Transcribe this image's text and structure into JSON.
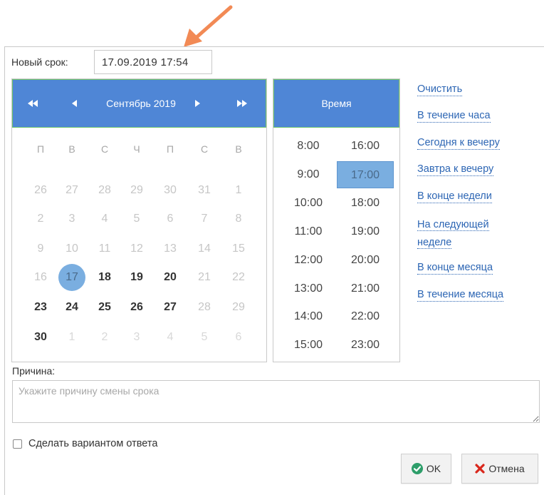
{
  "deadline": {
    "label": "Новый срок:",
    "value": "17.09.2019 17:54"
  },
  "calendar": {
    "month_title": "Сентябрь 2019",
    "weekdays": [
      "П",
      "В",
      "С",
      "Ч",
      "П",
      "С",
      "В"
    ],
    "weeks": [
      [
        [
          "26",
          "muted"
        ],
        [
          "27",
          "muted"
        ],
        [
          "28",
          "muted"
        ],
        [
          "29",
          "muted"
        ],
        [
          "30",
          "muted"
        ],
        [
          "31",
          "muted"
        ],
        [
          "1",
          "muted"
        ]
      ],
      [
        [
          "2",
          "muted"
        ],
        [
          "3",
          "muted"
        ],
        [
          "4",
          "muted"
        ],
        [
          "5",
          "muted"
        ],
        [
          "6",
          "muted"
        ],
        [
          "7",
          "muted"
        ],
        [
          "8",
          "muted"
        ]
      ],
      [
        [
          "9",
          "muted"
        ],
        [
          "10",
          "muted"
        ],
        [
          "11",
          "muted"
        ],
        [
          "12",
          "muted"
        ],
        [
          "13",
          "muted"
        ],
        [
          "14",
          "muted"
        ],
        [
          "15",
          "muted"
        ]
      ],
      [
        [
          "16",
          "muted"
        ],
        [
          "17",
          "selected"
        ],
        [
          "18",
          "current"
        ],
        [
          "19",
          "current"
        ],
        [
          "20",
          "current"
        ],
        [
          "21",
          "muted"
        ],
        [
          "22",
          "muted"
        ]
      ],
      [
        [
          "23",
          "current"
        ],
        [
          "24",
          "current"
        ],
        [
          "25",
          "current"
        ],
        [
          "26",
          "current"
        ],
        [
          "27",
          "current"
        ],
        [
          "28",
          "muted"
        ],
        [
          "29",
          "muted"
        ]
      ],
      [
        [
          "30",
          "current"
        ],
        [
          "1",
          "faint"
        ],
        [
          "2",
          "faint"
        ],
        [
          "3",
          "faint"
        ],
        [
          "4",
          "faint"
        ],
        [
          "5",
          "faint"
        ],
        [
          "6",
          "faint"
        ]
      ]
    ]
  },
  "time": {
    "header": "Время",
    "left_column": [
      "8:00",
      "9:00",
      "10:00",
      "11:00",
      "12:00",
      "13:00",
      "14:00",
      "15:00"
    ],
    "right_column": [
      "16:00",
      "17:00",
      "18:00",
      "19:00",
      "20:00",
      "21:00",
      "22:00",
      "23:00"
    ],
    "selected": "17:00"
  },
  "quick_links": {
    "clear": "Очистить",
    "within_hour": "В течение часа",
    "today_evening": "Сегодня к вечеру",
    "tomorrow_evening": "Завтра к вечеру",
    "end_of_week": "В конце недели",
    "next_week_line1": "На следующей",
    "next_week_line2": "неделе",
    "end_of_month": "В конце месяца",
    "within_month": "В течение месяца"
  },
  "reason": {
    "label": "Причина:",
    "placeholder": "Укажите причину смены срока"
  },
  "answer_option": {
    "label": "Сделать вариантом ответа",
    "checked": false
  },
  "buttons": {
    "ok": "OK",
    "cancel": "Отмена"
  },
  "colors": {
    "header_blue": "#4f86d6",
    "selected_blue": "#7aaee0",
    "link_blue": "#2d66b4",
    "ok_green": "#2e9e6a",
    "cancel_red": "#d9271c",
    "arrow_orange": "#f28a55"
  },
  "icons": {
    "prev_year": "double-left-arrow",
    "prev_month": "left-arrow",
    "next_month": "right-arrow",
    "next_year": "double-right-arrow",
    "ok": "check-circle-icon",
    "cancel": "x-icon",
    "annotation": "orange-arrow"
  }
}
